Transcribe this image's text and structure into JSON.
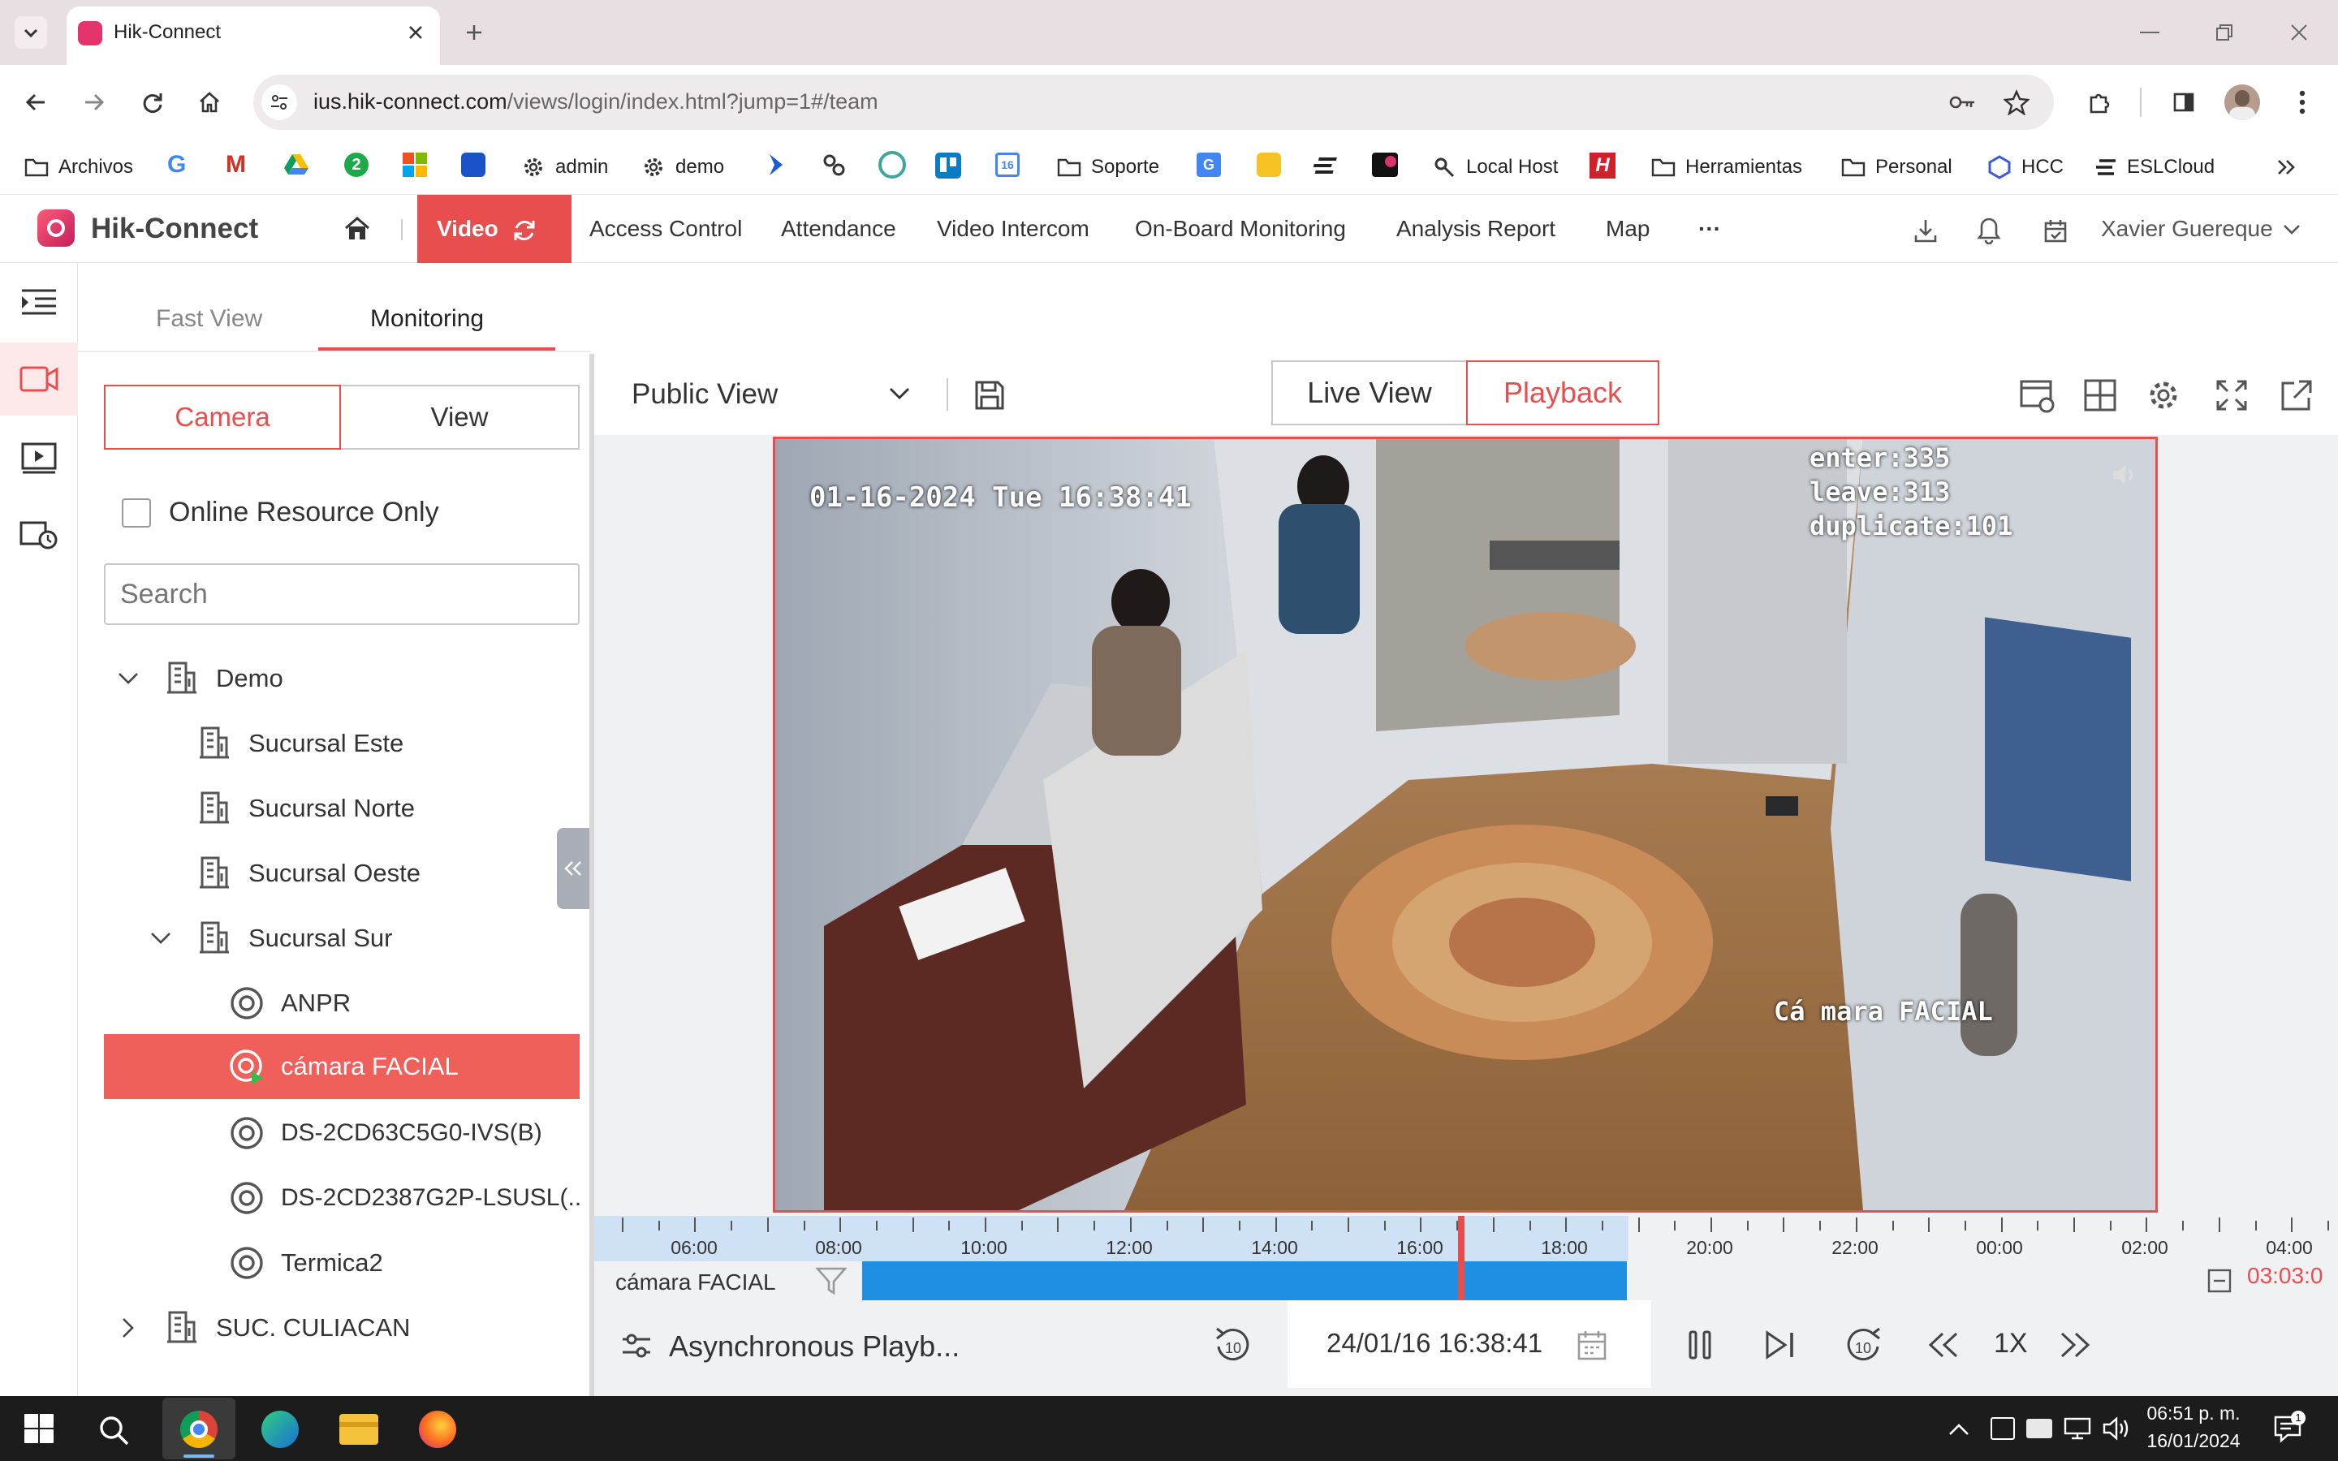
{
  "browser": {
    "tab_title": "Hik-Connect",
    "url_host": "ius.hik-connect.com",
    "url_path": "/views/login/index.html?jump=1#/team",
    "bookmarks": [
      "Archivos",
      "admin",
      "demo",
      "Soporte",
      "Local Host",
      "Herramientas",
      "Personal",
      "HCC",
      "ESLCloud"
    ]
  },
  "app": {
    "brand": "Hik-Connect",
    "accent": "#e94e4e",
    "nav": [
      "Video",
      "Access Control",
      "Attendance",
      "Video Intercom",
      "On-Board Monitoring",
      "Analysis Report",
      "Map",
      "···"
    ],
    "user": "Xavier Guereque"
  },
  "sidebar": {
    "tabs": [
      "Fast View",
      "Monitoring"
    ],
    "toggle": [
      "Camera",
      "View"
    ],
    "online_only": "Online Resource Only",
    "search_placeholder": "Search",
    "tree": [
      "Demo",
      "Sucursal Este",
      "Sucursal Norte",
      "Sucursal Oeste",
      "Sucursal Sur",
      "ANPR",
      "cámara FACIAL",
      "DS-2CD63C5G0-IVS(B)",
      "DS-2CD2387G2P-LSUSL(..",
      "Termica2",
      "SUC. CULIACAN"
    ]
  },
  "main": {
    "view_select": "Public View",
    "mode_tabs": [
      "Live View",
      "Playback"
    ],
    "osd": {
      "timestamp": "01-16-2024 Tue 16:38:41",
      "enter": "enter:335",
      "leave": "leave:313",
      "duplicate": "duplicate:101",
      "camera_name": "Cá mara FACIAL"
    },
    "timeline": {
      "labels": [
        "06:00",
        "08:00",
        "10:00",
        "12:00",
        "14:00",
        "16:00",
        "18:00",
        "20:00",
        "22:00",
        "00:00",
        "02:00",
        "04:00"
      ],
      "camera": "cámara FACIAL",
      "end_time": "03:03:0"
    },
    "controls": {
      "async": "Asynchronous Playb...",
      "datetime": "24/01/16 16:38:41",
      "speed": "1X"
    }
  },
  "taskbar": {
    "time": "06:51 p. m.",
    "date": "16/01/2024"
  }
}
